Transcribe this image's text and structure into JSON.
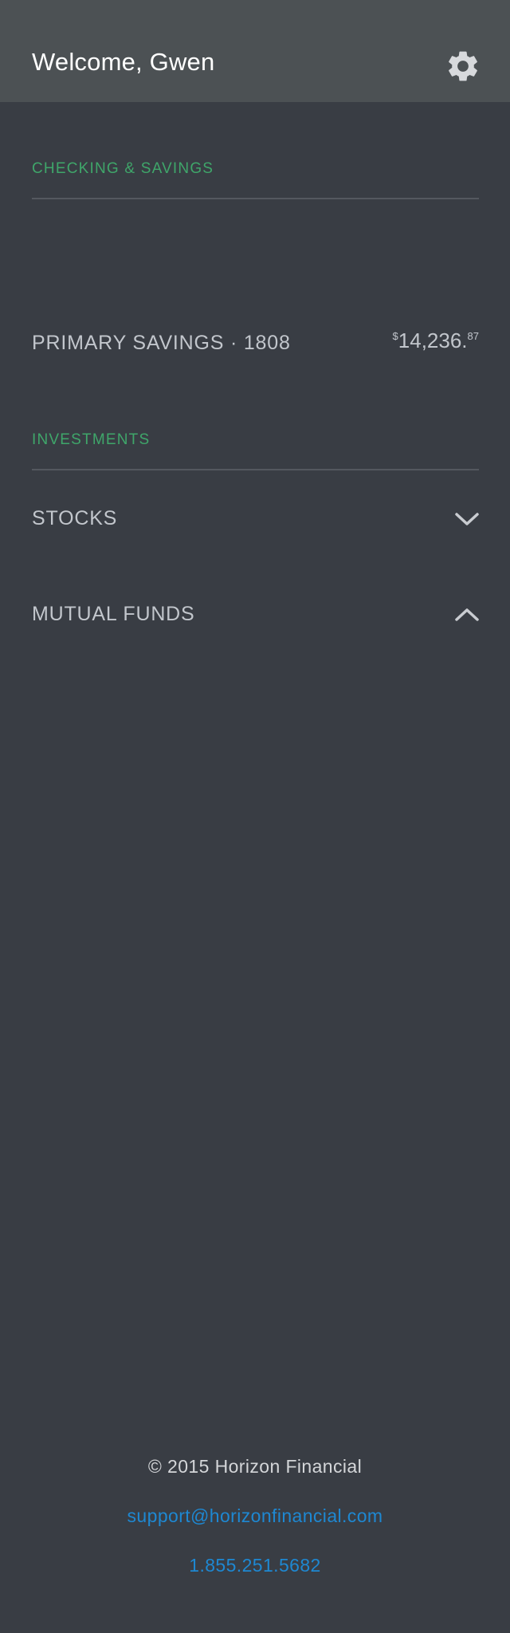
{
  "header": {
    "title": "Welcome, Gwen",
    "settings_icon": "gear-icon"
  },
  "sections": {
    "checking_savings": {
      "label": "CHECKING & SAVINGS",
      "account": {
        "name": "PRIMARY SAVINGS · 1808",
        "currency": "$",
        "amount_main": "14,236.",
        "amount_cents": "87"
      }
    },
    "investments": {
      "label": "INVESTMENTS",
      "items": [
        {
          "label": "STOCKS",
          "chevron": "chevron-down-icon"
        },
        {
          "label": "MUTUAL FUNDS",
          "chevron": "chevron-up-icon"
        }
      ]
    }
  },
  "footer": {
    "copyright": "© 2015 Horizon Financial",
    "email": "support@horizonfinancial.com",
    "phone": "1.855.251.5682"
  },
  "colors": {
    "background": "#393d44",
    "header": "#4c5154",
    "section_label": "#3fa66a",
    "link": "#1e88d2",
    "text": "#c2c6cc"
  }
}
